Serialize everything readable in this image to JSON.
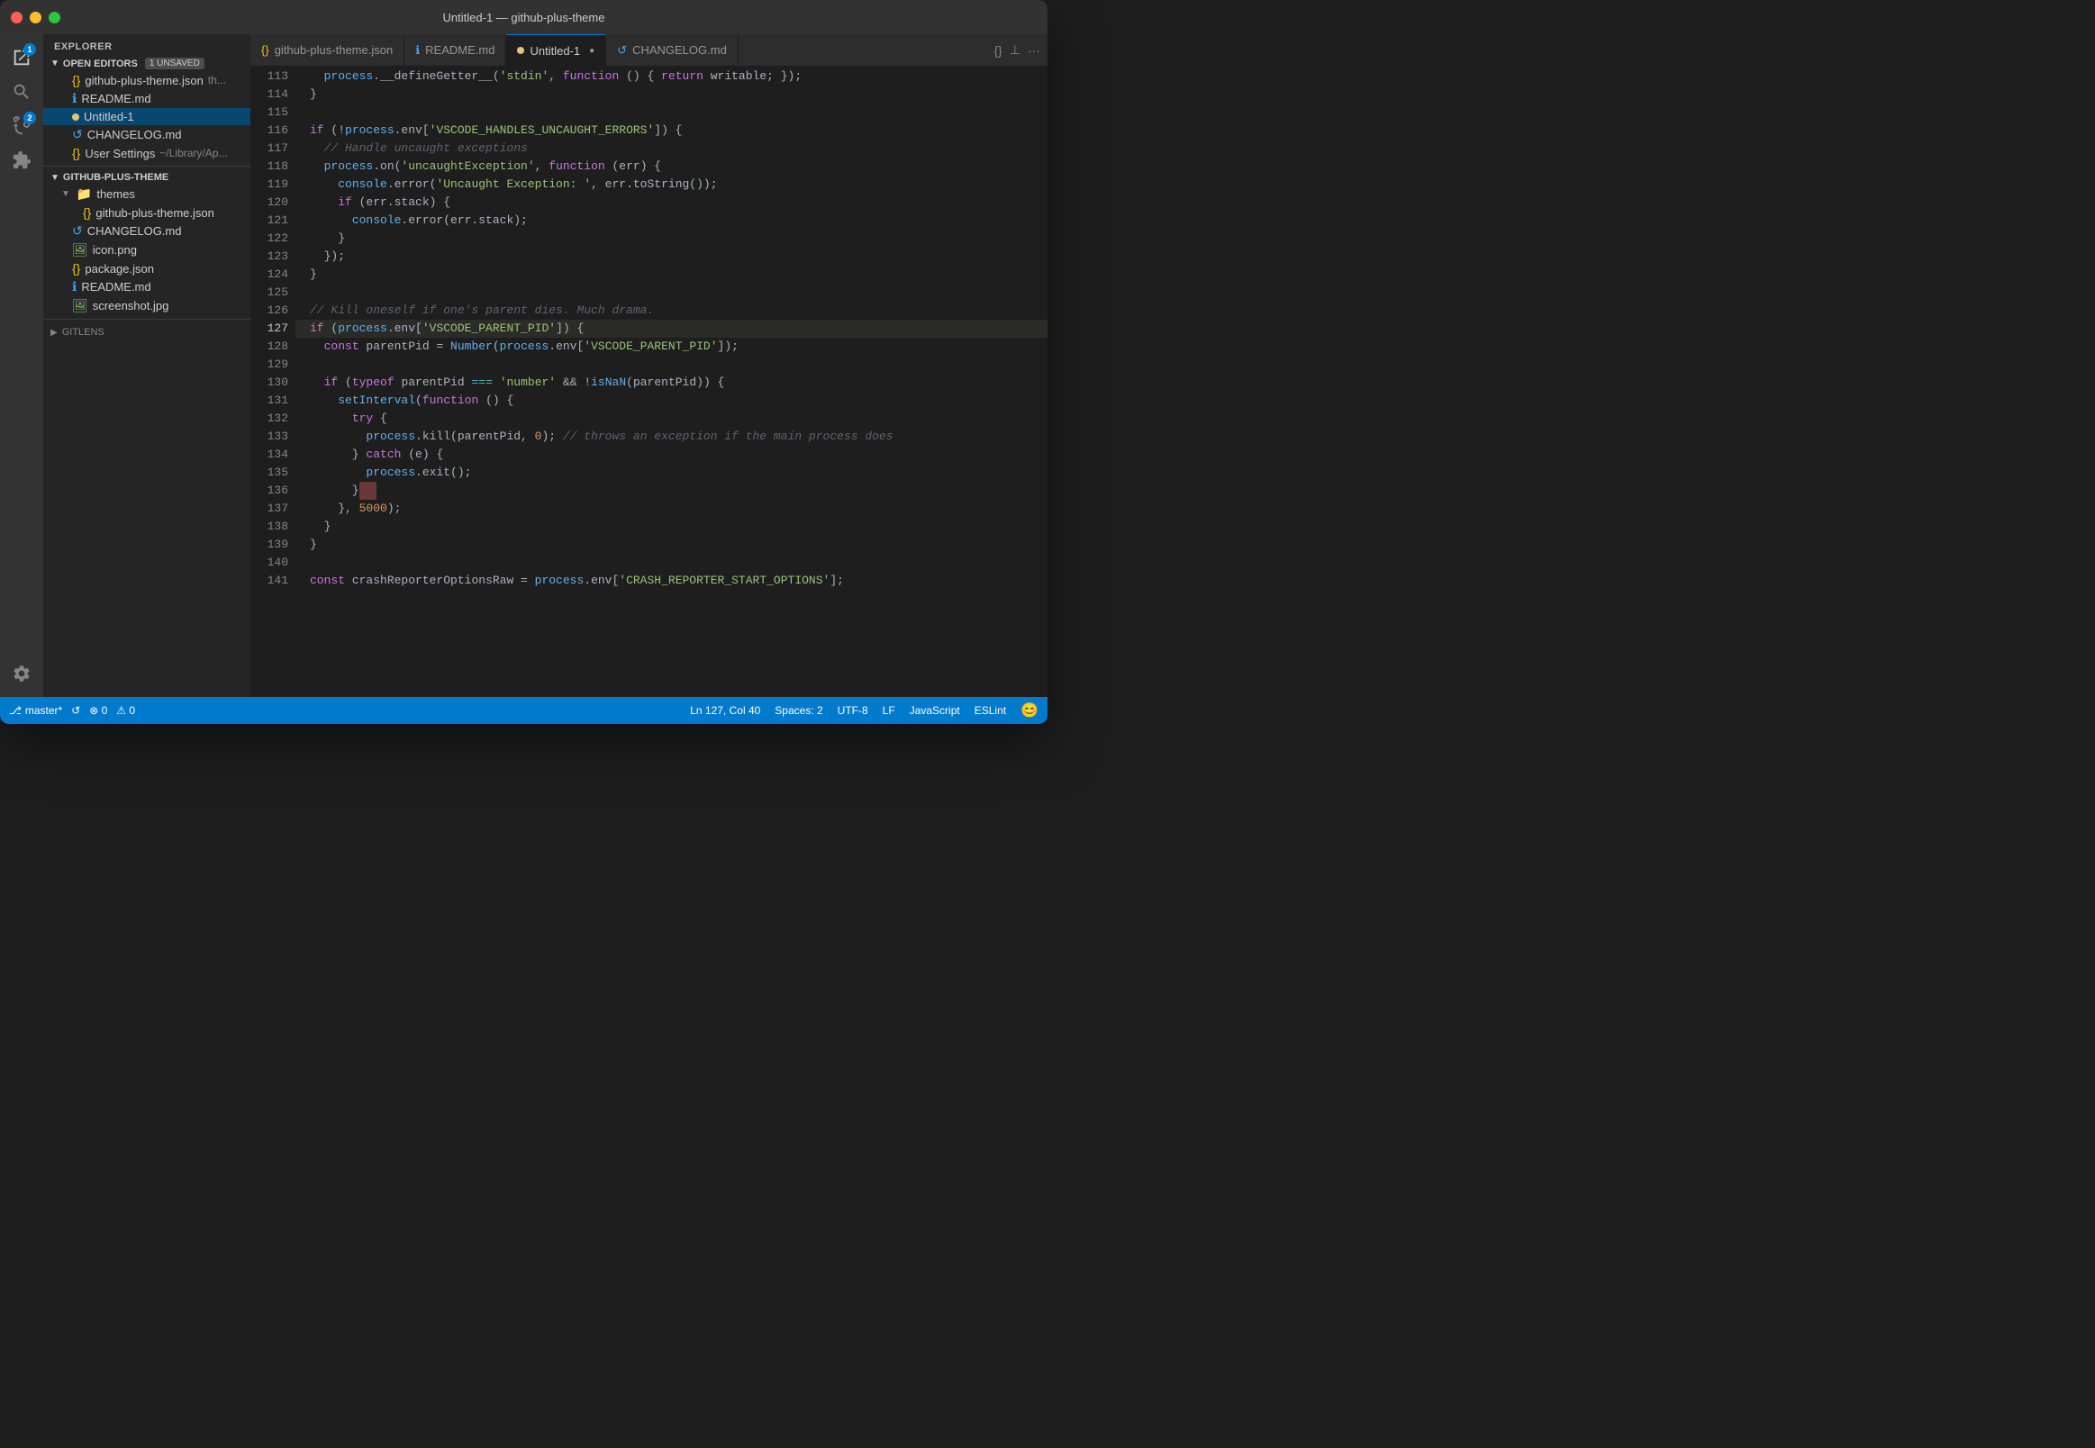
{
  "titleBar": {
    "title": "Untitled-1 — github-plus-theme"
  },
  "activityBar": {
    "icons": [
      {
        "name": "explorer-icon",
        "symbol": "⎘",
        "label": "Explorer",
        "active": true,
        "badge": "1"
      },
      {
        "name": "search-icon",
        "symbol": "🔍",
        "label": "Search",
        "active": false
      },
      {
        "name": "source-control-icon",
        "symbol": "⑂",
        "label": "Source Control",
        "active": false,
        "badge": "2"
      },
      {
        "name": "extensions-icon",
        "symbol": "⊞",
        "label": "Extensions",
        "active": false
      }
    ],
    "bottomIcons": [
      {
        "name": "settings-icon",
        "symbol": "⚙",
        "label": "Settings"
      }
    ]
  },
  "sidebar": {
    "explorerTitle": "EXPLORER",
    "openEditors": {
      "label": "OPEN EDITORS",
      "badge": "1 UNSAVED",
      "files": [
        {
          "name": "github-plus-theme.json",
          "icon": "json",
          "preview": "th...",
          "indent": 2
        },
        {
          "name": "README.md",
          "icon": "md",
          "indent": 2
        },
        {
          "name": "Untitled-1",
          "icon": "dot",
          "active": true,
          "indent": 2
        },
        {
          "name": "CHANGELOG.md",
          "icon": "changelog",
          "indent": 2
        },
        {
          "name": "User Settings",
          "icon": "json",
          "preview": "~/Library/Ap...",
          "indent": 2
        }
      ]
    },
    "project": {
      "label": "GITHUB-PLUS-THEME",
      "items": [
        {
          "type": "folder",
          "name": "themes",
          "expanded": true,
          "indent": 1
        },
        {
          "type": "file",
          "name": "github-plus-theme.json",
          "icon": "json",
          "indent": 2
        },
        {
          "type": "file",
          "name": "CHANGELOG.md",
          "icon": "changelog",
          "indent": 1
        },
        {
          "type": "file",
          "name": "icon.png",
          "icon": "png",
          "indent": 1
        },
        {
          "type": "file",
          "name": "package.json",
          "icon": "json",
          "indent": 1
        },
        {
          "type": "file",
          "name": "README.md",
          "icon": "md",
          "indent": 1
        },
        {
          "type": "file",
          "name": "screenshot.jpg",
          "icon": "jpg",
          "indent": 1
        }
      ]
    },
    "gitlens": "GITLENS"
  },
  "tabs": [
    {
      "name": "github-plus-theme.json",
      "icon": "json",
      "active": false
    },
    {
      "name": "README.md",
      "icon": "md",
      "active": false
    },
    {
      "name": "Untitled-1",
      "icon": "dot",
      "active": true,
      "modified": true
    },
    {
      "name": "CHANGELOG.md",
      "icon": "changelog",
      "active": false
    }
  ],
  "editor": {
    "lines": [
      {
        "num": "113",
        "content": "  process.__defineGetter__('stdin', function () { return writable; });"
      },
      {
        "num": "114",
        "content": "}"
      },
      {
        "num": "115",
        "content": ""
      },
      {
        "num": "116",
        "content": "if (!process.env['VSCODE_HANDLES_UNCAUGHT_ERRORS']) {"
      },
      {
        "num": "117",
        "content": "  // Handle uncaught exceptions"
      },
      {
        "num": "118",
        "content": "  process.on('uncaughtException', function (err) {"
      },
      {
        "num": "119",
        "content": "    console.error('Uncaught Exception: ', err.toString());"
      },
      {
        "num": "120",
        "content": "    if (err.stack) {"
      },
      {
        "num": "121",
        "content": "      console.error(err.stack);"
      },
      {
        "num": "122",
        "content": "    }"
      },
      {
        "num": "123",
        "content": "  });"
      },
      {
        "num": "124",
        "content": "}"
      },
      {
        "num": "125",
        "content": ""
      },
      {
        "num": "126",
        "content": "// Kill oneself if one's parent dies. Much drama."
      },
      {
        "num": "127",
        "content": "if (process.env['VSCODE_PARENT_PID']) {",
        "highlighted": true
      },
      {
        "num": "128",
        "content": "  const parentPid = Number(process.env['VSCODE_PARENT_PID']);"
      },
      {
        "num": "129",
        "content": ""
      },
      {
        "num": "130",
        "content": "  if (typeof parentPid === 'number' && !isNaN(parentPid)) {"
      },
      {
        "num": "131",
        "content": "    setInterval(function () {"
      },
      {
        "num": "132",
        "content": "      try {"
      },
      {
        "num": "133",
        "content": "        process.kill(parentPid, 0); // throws an exception if the main process does"
      },
      {
        "num": "134",
        "content": "      } catch (e) {"
      },
      {
        "num": "135",
        "content": "        process.exit();"
      },
      {
        "num": "136",
        "content": "      }"
      },
      {
        "num": "137",
        "content": "    }, 5000);"
      },
      {
        "num": "138",
        "content": "  }"
      },
      {
        "num": "139",
        "content": "}"
      },
      {
        "num": "140",
        "content": ""
      },
      {
        "num": "141",
        "content": "const crashReporterOptionsRaw = process.env['CRASH_REPORTER_START_OPTIONS'];"
      }
    ]
  },
  "statusBar": {
    "branch": "master*",
    "sync": "↺",
    "errors": "⊗ 0",
    "warnings": "⚠ 0",
    "position": "Ln 127, Col 40",
    "spaces": "Spaces: 2",
    "encoding": "UTF-8",
    "lineEnding": "LF",
    "language": "JavaScript",
    "linter": "ESLint",
    "smiley": "😊"
  }
}
